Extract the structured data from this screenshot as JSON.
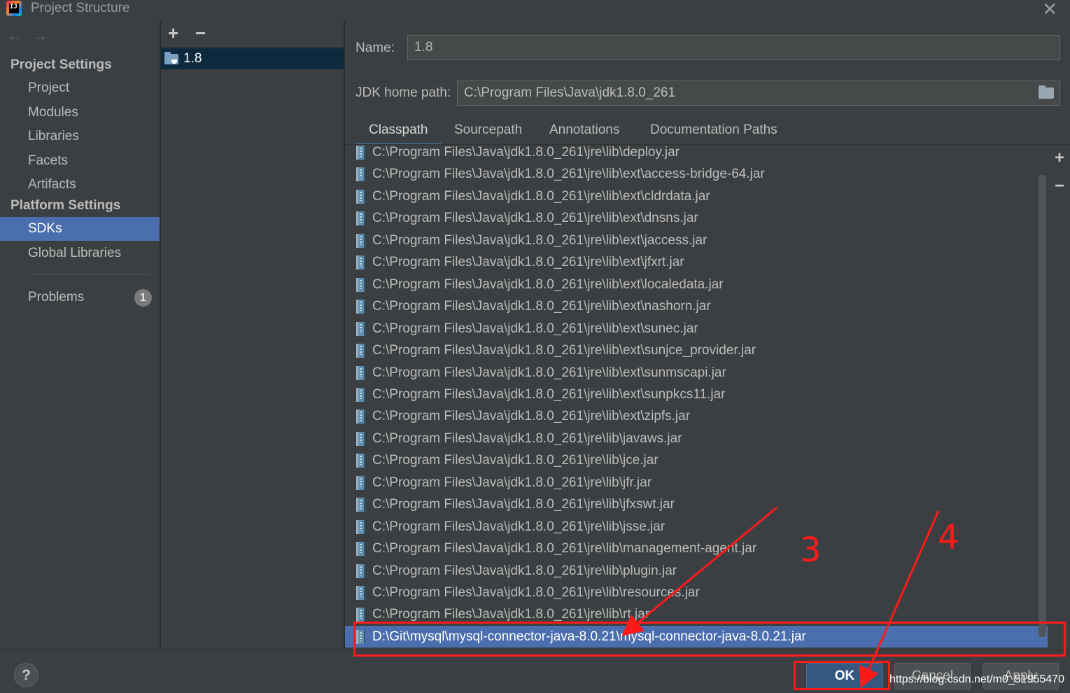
{
  "window": {
    "title": "Project Structure",
    "app_icon_text": "IJ",
    "close_icon": "close-icon"
  },
  "nav": {
    "project_settings_header": "Project Settings",
    "platform_settings_header": "Platform Settings",
    "items": [
      {
        "label": "Project"
      },
      {
        "label": "Modules"
      },
      {
        "label": "Libraries"
      },
      {
        "label": "Facets"
      },
      {
        "label": "Artifacts"
      },
      {
        "label": "SDKs",
        "selected": true
      },
      {
        "label": "Global Libraries"
      }
    ],
    "problems": {
      "label": "Problems",
      "count": "1"
    },
    "back_icon": "back-arrow-icon",
    "forward_icon": "forward-arrow-icon"
  },
  "sdk_list": {
    "add_label": "+",
    "remove_label": "−",
    "items": [
      {
        "label": "1.8",
        "icon": "folder-icon",
        "selected": true
      }
    ]
  },
  "sdk_detail": {
    "name_label": "Name:",
    "name_value": "1.8",
    "home_label": "JDK home path:",
    "home_value": "C:\\Program Files\\Java\\jdk1.8.0_261",
    "tabs": [
      "Classpath",
      "Sourcepath",
      "Annotations",
      "Documentation Paths"
    ],
    "active_tab": "Classpath",
    "classpath": [
      "C:\\Program Files\\Java\\jdk1.8.0_261\\jre\\lib\\deploy.jar",
      "C:\\Program Files\\Java\\jdk1.8.0_261\\jre\\lib\\ext\\access-bridge-64.jar",
      "C:\\Program Files\\Java\\jdk1.8.0_261\\jre\\lib\\ext\\cldrdata.jar",
      "C:\\Program Files\\Java\\jdk1.8.0_261\\jre\\lib\\ext\\dnsns.jar",
      "C:\\Program Files\\Java\\jdk1.8.0_261\\jre\\lib\\ext\\jaccess.jar",
      "C:\\Program Files\\Java\\jdk1.8.0_261\\jre\\lib\\ext\\jfxrt.jar",
      "C:\\Program Files\\Java\\jdk1.8.0_261\\jre\\lib\\ext\\localedata.jar",
      "C:\\Program Files\\Java\\jdk1.8.0_261\\jre\\lib\\ext\\nashorn.jar",
      "C:\\Program Files\\Java\\jdk1.8.0_261\\jre\\lib\\ext\\sunec.jar",
      "C:\\Program Files\\Java\\jdk1.8.0_261\\jre\\lib\\ext\\sunjce_provider.jar",
      "C:\\Program Files\\Java\\jdk1.8.0_261\\jre\\lib\\ext\\sunmscapi.jar",
      "C:\\Program Files\\Java\\jdk1.8.0_261\\jre\\lib\\ext\\sunpkcs11.jar",
      "C:\\Program Files\\Java\\jdk1.8.0_261\\jre\\lib\\ext\\zipfs.jar",
      "C:\\Program Files\\Java\\jdk1.8.0_261\\jre\\lib\\javaws.jar",
      "C:\\Program Files\\Java\\jdk1.8.0_261\\jre\\lib\\jce.jar",
      "C:\\Program Files\\Java\\jdk1.8.0_261\\jre\\lib\\jfr.jar",
      "C:\\Program Files\\Java\\jdk1.8.0_261\\jre\\lib\\jfxswt.jar",
      "C:\\Program Files\\Java\\jdk1.8.0_261\\jre\\lib\\jsse.jar",
      "C:\\Program Files\\Java\\jdk1.8.0_261\\jre\\lib\\management-agent.jar",
      "C:\\Program Files\\Java\\jdk1.8.0_261\\jre\\lib\\plugin.jar",
      "C:\\Program Files\\Java\\jdk1.8.0_261\\jre\\lib\\resources.jar",
      "C:\\Program Files\\Java\\jdk1.8.0_261\\jre\\lib\\rt.jar",
      "D:\\Git\\mysql\\mysql-connector-java-8.0.21\\mysql-connector-java-8.0.21.jar"
    ],
    "selected_index": 22,
    "side_add_label": "+",
    "side_remove_label": "−"
  },
  "footer": {
    "help_label": "?",
    "ok_label": "OK",
    "cancel_label": "Cancel",
    "apply_label": "Apply",
    "watermark": "https://blog.csdn.net/m0_51955470"
  },
  "annotations": {
    "step3": "3",
    "step4": "4",
    "color": "#ff1a1a"
  },
  "colors": {
    "background": "#3c3f41",
    "selection": "#4b6eaf",
    "sdk_selection": "#0d293e",
    "ok_button": "#365880"
  }
}
